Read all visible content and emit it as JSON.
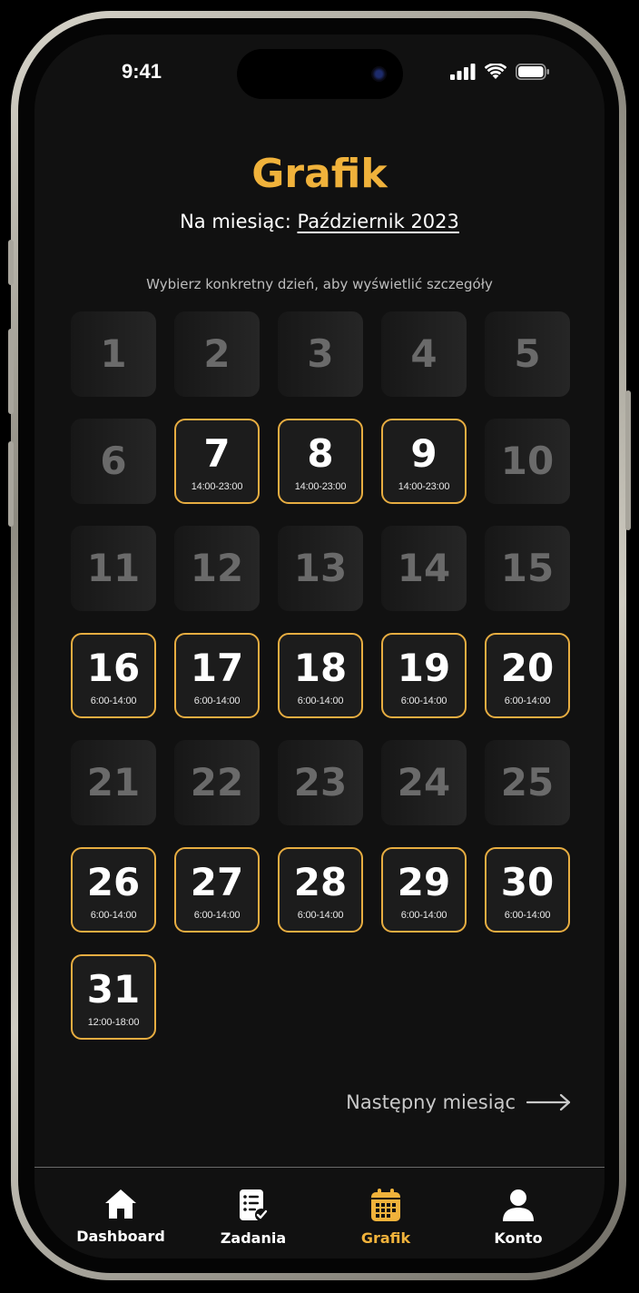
{
  "status_bar": {
    "time": "9:41"
  },
  "header": {
    "title": "Grafik",
    "subtitle_prefix": "Na miesiąc: ",
    "month": "Październik 2023",
    "hint": "Wybierz konkretny dzień, aby wyświetlić szczegóły"
  },
  "days": [
    {
      "day": "1",
      "hours": ""
    },
    {
      "day": "2",
      "hours": ""
    },
    {
      "day": "3",
      "hours": ""
    },
    {
      "day": "4",
      "hours": ""
    },
    {
      "day": "5",
      "hours": ""
    },
    {
      "day": "6",
      "hours": ""
    },
    {
      "day": "7",
      "hours": "14:00-23:00"
    },
    {
      "day": "8",
      "hours": "14:00-23:00"
    },
    {
      "day": "9",
      "hours": "14:00-23:00"
    },
    {
      "day": "10",
      "hours": ""
    },
    {
      "day": "11",
      "hours": ""
    },
    {
      "day": "12",
      "hours": ""
    },
    {
      "day": "13",
      "hours": ""
    },
    {
      "day": "14",
      "hours": ""
    },
    {
      "day": "15",
      "hours": ""
    },
    {
      "day": "16",
      "hours": "6:00-14:00"
    },
    {
      "day": "17",
      "hours": "6:00-14:00"
    },
    {
      "day": "18",
      "hours": "6:00-14:00"
    },
    {
      "day": "19",
      "hours": "6:00-14:00"
    },
    {
      "day": "20",
      "hours": "6:00-14:00"
    },
    {
      "day": "21",
      "hours": ""
    },
    {
      "day": "22",
      "hours": ""
    },
    {
      "day": "23",
      "hours": ""
    },
    {
      "day": "24",
      "hours": ""
    },
    {
      "day": "25",
      "hours": ""
    },
    {
      "day": "26",
      "hours": "6:00-14:00"
    },
    {
      "day": "27",
      "hours": "6:00-14:00"
    },
    {
      "day": "28",
      "hours": "6:00-14:00"
    },
    {
      "day": "29",
      "hours": "6:00-14:00"
    },
    {
      "day": "30",
      "hours": "6:00-14:00"
    },
    {
      "day": "31",
      "hours": "12:00-18:00"
    }
  ],
  "next_month": {
    "label": "Następny miesiąc",
    "icon": "arrow-right-icon"
  },
  "tabbar": {
    "items": [
      {
        "label": "Dashboard",
        "icon": "home-icon"
      },
      {
        "label": "Zadania",
        "icon": "tasks-icon"
      },
      {
        "label": "Grafik",
        "icon": "calendar-icon"
      },
      {
        "label": "Konto",
        "icon": "user-icon"
      }
    ],
    "active": "Grafik"
  },
  "colors": {
    "accent": "#f0b23b",
    "background": "#111111",
    "inactive_day": "#6a6a6a"
  }
}
